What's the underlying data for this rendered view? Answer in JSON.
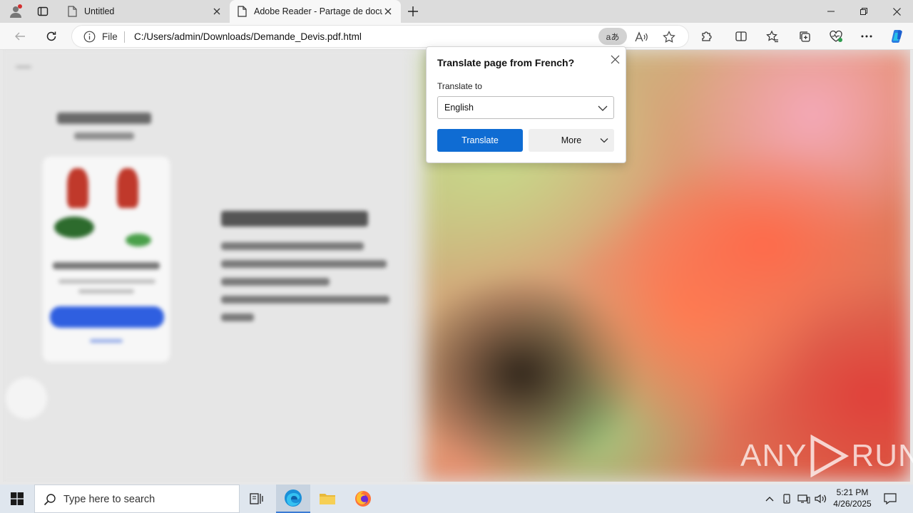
{
  "browser": {
    "tabs": [
      {
        "title": "Untitled",
        "active": false
      },
      {
        "title": "Adobe Reader - Partage de docum",
        "active": true
      }
    ],
    "address": {
      "scheme_label": "File",
      "url": "C:/Users/admin/Downloads/Demande_Devis.pdf.html"
    },
    "translate_indicator": "aあ"
  },
  "translate_popup": {
    "title": "Translate page from French?",
    "translate_to_label": "Translate to",
    "selected_language": "English",
    "translate_button": "Translate",
    "more_button": "More"
  },
  "watermark": {
    "text_left": "ANY",
    "text_right": "RUN"
  },
  "taskbar": {
    "search_placeholder": "Type here to search",
    "time": "5:21 PM",
    "date": "4/26/2025"
  },
  "colors": {
    "accent": "#0f6cd3",
    "tabstrip": "#dcdcdc",
    "taskbar": "#dfe6ee"
  }
}
